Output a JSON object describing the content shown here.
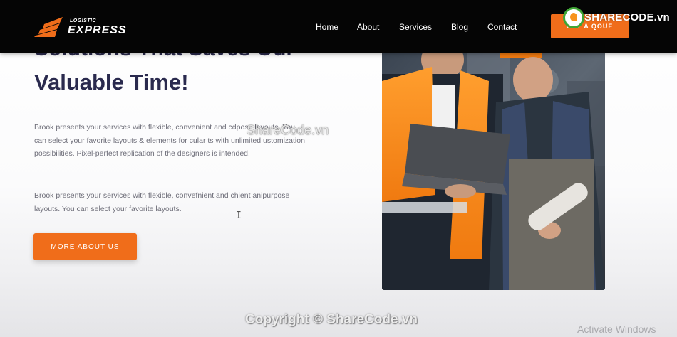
{
  "brand": {
    "small": "LOGISTIC",
    "big": "EXPRESS",
    "accent_color": "#f06d1a"
  },
  "nav": {
    "items": [
      {
        "label": "Home"
      },
      {
        "label": "About"
      },
      {
        "label": "Services"
      },
      {
        "label": "Blog"
      },
      {
        "label": "Contact"
      }
    ],
    "quote_label": "GET A QOUE"
  },
  "hero": {
    "heading_cut": "Solutions That Saves Our",
    "heading": "Valuable Time!",
    "para1": "Brook presents your services with flexible, convenient and cdpose layouts. You can select your favorite layouts & elements for cular ts with unlimited ustomization possibilities. Pixel-perfect replication of the designers is intended.",
    "para2": "Brook presents your services with flexible, convefnient and chient anipurpose layouts. You can select your favorite layouts.",
    "button_label": "MORE ABOUT US",
    "text_color": "#2a2a4e"
  },
  "watermark": {
    "logo_text": "SHARECODE.vn",
    "middle": "ShareCode.vn",
    "bottom": "Copyright © ShareCode.vn"
  },
  "os": {
    "activate_text": "Activate Windows"
  },
  "icons": {
    "brand": "logistic-wing-icon",
    "cursor": "text-cursor-icon",
    "watermark": "sharecode-icon"
  }
}
